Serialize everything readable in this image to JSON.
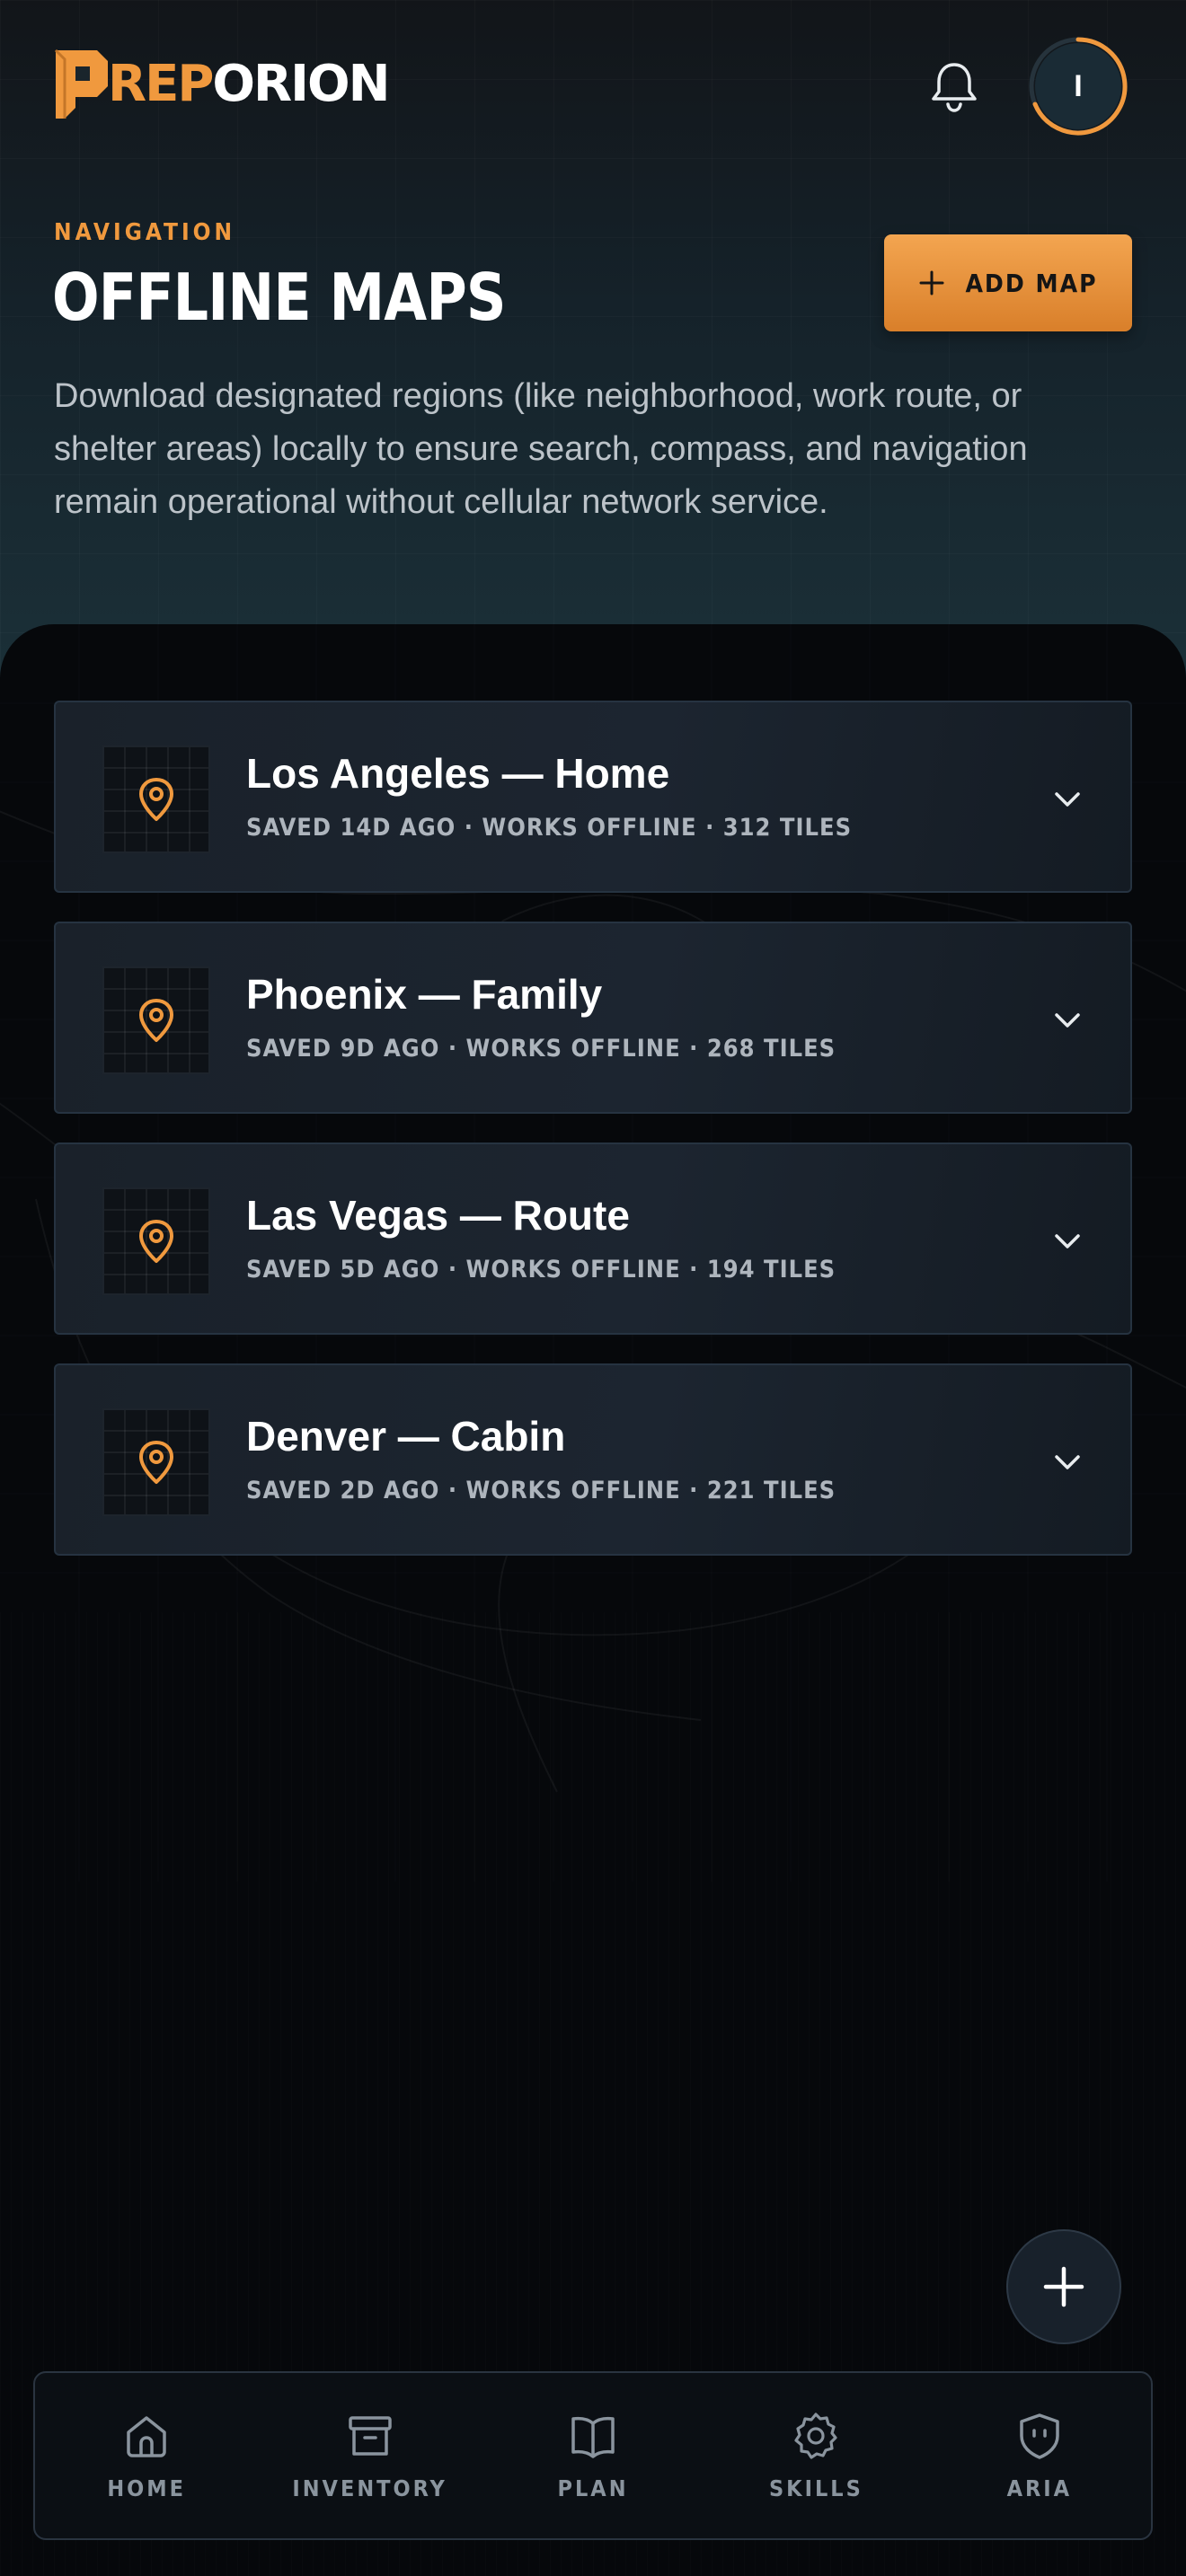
{
  "app": {
    "logo_letter": "P",
    "logo_part1": "REP",
    "logo_part2": "ORION",
    "avatar_initial": "I"
  },
  "header": {
    "eyebrow": "NAVIGATION",
    "title": "OFFLINE MAPS",
    "add_button_label": "ADD MAP",
    "description": "Download designated regions (like neighborhood, work route, or shelter areas) locally to ensure search, compass, and navigation remain operational without cellular network service."
  },
  "maps": [
    {
      "title": "Los Angeles — Home",
      "meta": "SAVED 14D AGO · WORKS OFFLINE · 312 TILES"
    },
    {
      "title": "Phoenix — Family",
      "meta": "SAVED 9D AGO · WORKS OFFLINE · 268 TILES"
    },
    {
      "title": "Las Vegas — Route",
      "meta": "SAVED 5D AGO · WORKS OFFLINE · 194 TILES"
    },
    {
      "title": "Denver — Cabin",
      "meta": "SAVED 2D AGO · WORKS OFFLINE · 221 TILES"
    }
  ],
  "nav": {
    "items": [
      {
        "label": "HOME",
        "icon": "home-icon"
      },
      {
        "label": "INVENTORY",
        "icon": "archive-box-icon"
      },
      {
        "label": "PLAN",
        "icon": "open-book-icon"
      },
      {
        "label": "SKILLS",
        "icon": "badge-gear-icon"
      },
      {
        "label": "ARIA",
        "icon": "shield-face-icon"
      }
    ]
  },
  "colors": {
    "accent": "#f0993e",
    "background": "#06080b",
    "card": "#1a212a"
  }
}
